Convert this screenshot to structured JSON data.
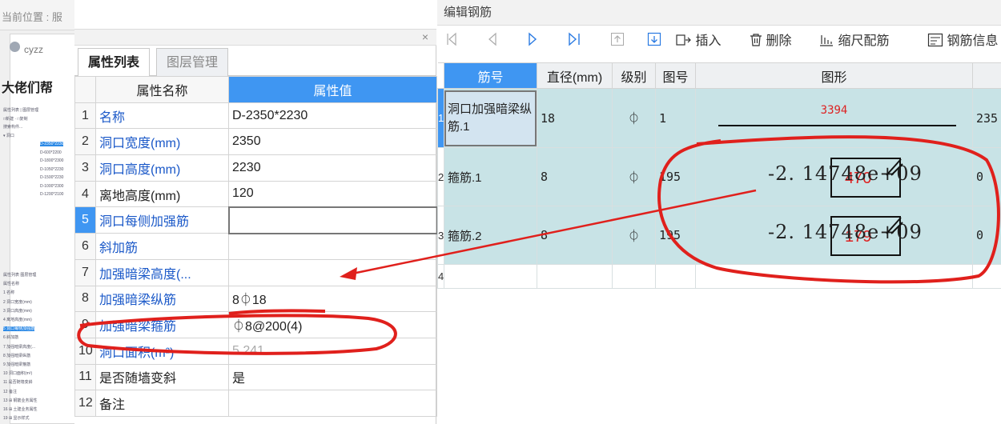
{
  "background": {
    "location_text": "当前位置 : 服",
    "username": "cyzz",
    "post_title": "大佬们帮",
    "mini_rows_top": [
      "属性列表 | 图层管理",
      "□新建 · □复制",
      "搜索构件...",
      "▾ 洞口",
      "D-2350*2230",
      "D-600*2200",
      "D-1800*2300",
      "D-1050*2230",
      "D-1500*2230",
      "D-1000*2300",
      "D-1200*2100"
    ],
    "mini_rows_bottom": [
      "属性列表  图层管理",
      "属性名称",
      "1 名称",
      "2 洞口宽度(mm)",
      "3 洞口高度(mm)",
      "4 离地高度(mm)",
      "5 洞口每侧加强筋",
      "6 斜加筋",
      "7 加强暗梁高度(...",
      "8 加强暗梁纵筋",
      "9 加强暗梁箍筋",
      "10 洞口面积(m²)",
      "11 是否随墙变斜",
      "12 备注",
      "13 ⊞ 钢筋业务属性",
      "16 ⊞ 土建业务属性",
      "19 ⊞ 显示样式"
    ]
  },
  "props_panel": {
    "close_glyph": "×",
    "tabs": [
      "属性列表",
      "图层管理"
    ],
    "headers": {
      "num": "",
      "name": "属性名称",
      "value": "属性值"
    },
    "rows": [
      {
        "num": "1",
        "name": "名称",
        "value": "D-2350*2230"
      },
      {
        "num": "2",
        "name": "洞口宽度(mm)",
        "value": "2350"
      },
      {
        "num": "3",
        "name": "洞口高度(mm)",
        "value": "2230"
      },
      {
        "num": "4",
        "name": "离地高度(mm)",
        "value": "120"
      },
      {
        "num": "5",
        "name": "洞口每侧加强筋",
        "value": ""
      },
      {
        "num": "6",
        "name": "斜加筋",
        "value": ""
      },
      {
        "num": "7",
        "name": "加强暗梁高度(...",
        "value": ""
      },
      {
        "num": "8",
        "name": "加强暗梁纵筋",
        "value": "8⏀18"
      },
      {
        "num": "9",
        "name": "加强暗梁箍筋",
        "value": "⏀8@200(4)"
      },
      {
        "num": "10",
        "name": "洞口面积(m²)",
        "value": "5.241"
      },
      {
        "num": "11",
        "name": "是否随墙变斜",
        "value": "是"
      },
      {
        "num": "12",
        "name": "备注",
        "value": ""
      }
    ]
  },
  "rebar_editor": {
    "title": "编辑钢筋",
    "toolbar": {
      "insert": "插入",
      "delete": "删除",
      "scale": "缩尺配筋",
      "info": "钢筋信息"
    },
    "headers": [
      "筋号",
      "直径(mm)",
      "级别",
      "图号",
      "图形",
      ""
    ],
    "rows": [
      {
        "idx": "1",
        "name": "洞口加强暗梁纵筋.1",
        "diameter": "18",
        "grade": "⏀",
        "fig": "1",
        "shape_len": "3394",
        "extra": "235"
      },
      {
        "idx": "2",
        "name": "箍筋.1",
        "diameter": "8",
        "grade": "⏀",
        "fig": "195",
        "shape_num": "-2. 14748e+09",
        "shape_red": "470",
        "extra": "0"
      },
      {
        "idx": "3",
        "name": "箍筋.2",
        "diameter": "8",
        "grade": "⏀",
        "fig": "195",
        "shape_num": "-2. 14748e+09",
        "shape_red": "179",
        "extra": "0"
      },
      {
        "idx": "4",
        "name": "",
        "diameter": "",
        "grade": "",
        "fig": "",
        "extra": ""
      }
    ]
  },
  "colors": {
    "accent": "#3f96f2",
    "annotation": "#e0201c",
    "row_fill": "#c8e3e6"
  }
}
